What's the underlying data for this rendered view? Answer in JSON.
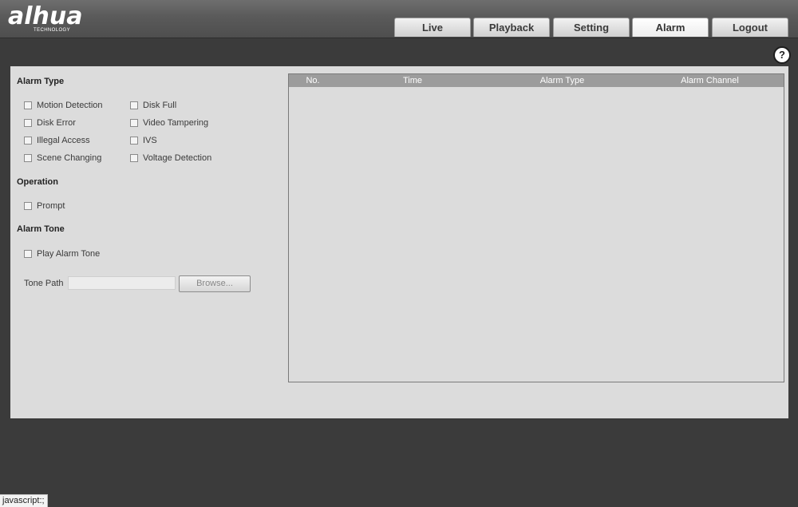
{
  "brand": {
    "logo": "alhua",
    "tagline": "TECHNOLOGY"
  },
  "nav": {
    "tabs": [
      {
        "label": "Live"
      },
      {
        "label": "Playback"
      },
      {
        "label": "Setting"
      },
      {
        "label": "Alarm",
        "active": true
      },
      {
        "label": "Logout"
      }
    ]
  },
  "help_icon": {
    "glyph": "?"
  },
  "alarm_type": {
    "title": "Alarm Type",
    "options": [
      {
        "label": "Motion Detection",
        "checked": false
      },
      {
        "label": "Disk Full",
        "checked": false
      },
      {
        "label": "Disk Error",
        "checked": false
      },
      {
        "label": "Video Tampering",
        "checked": false
      },
      {
        "label": "Illegal Access",
        "checked": false
      },
      {
        "label": "IVS",
        "checked": false
      },
      {
        "label": "Scene Changing",
        "checked": false
      },
      {
        "label": "Voltage Detection",
        "checked": false
      }
    ]
  },
  "operation": {
    "title": "Operation",
    "options": [
      {
        "label": "Prompt",
        "checked": false
      }
    ]
  },
  "alarm_tone": {
    "title": "Alarm Tone",
    "play_label": "Play Alarm Tone",
    "play_checked": false,
    "tone_path_label": "Tone Path",
    "tone_path_value": "",
    "browse_label": "Browse..."
  },
  "table": {
    "columns": [
      "No.",
      "Time",
      "Alarm Type",
      "Alarm Channel"
    ],
    "rows": []
  },
  "status_bar": {
    "text": "javascript:;"
  },
  "colors": {
    "background": "#3b3b3b",
    "panel": "#dcdcdc",
    "table_header": "#9c9c9c"
  }
}
